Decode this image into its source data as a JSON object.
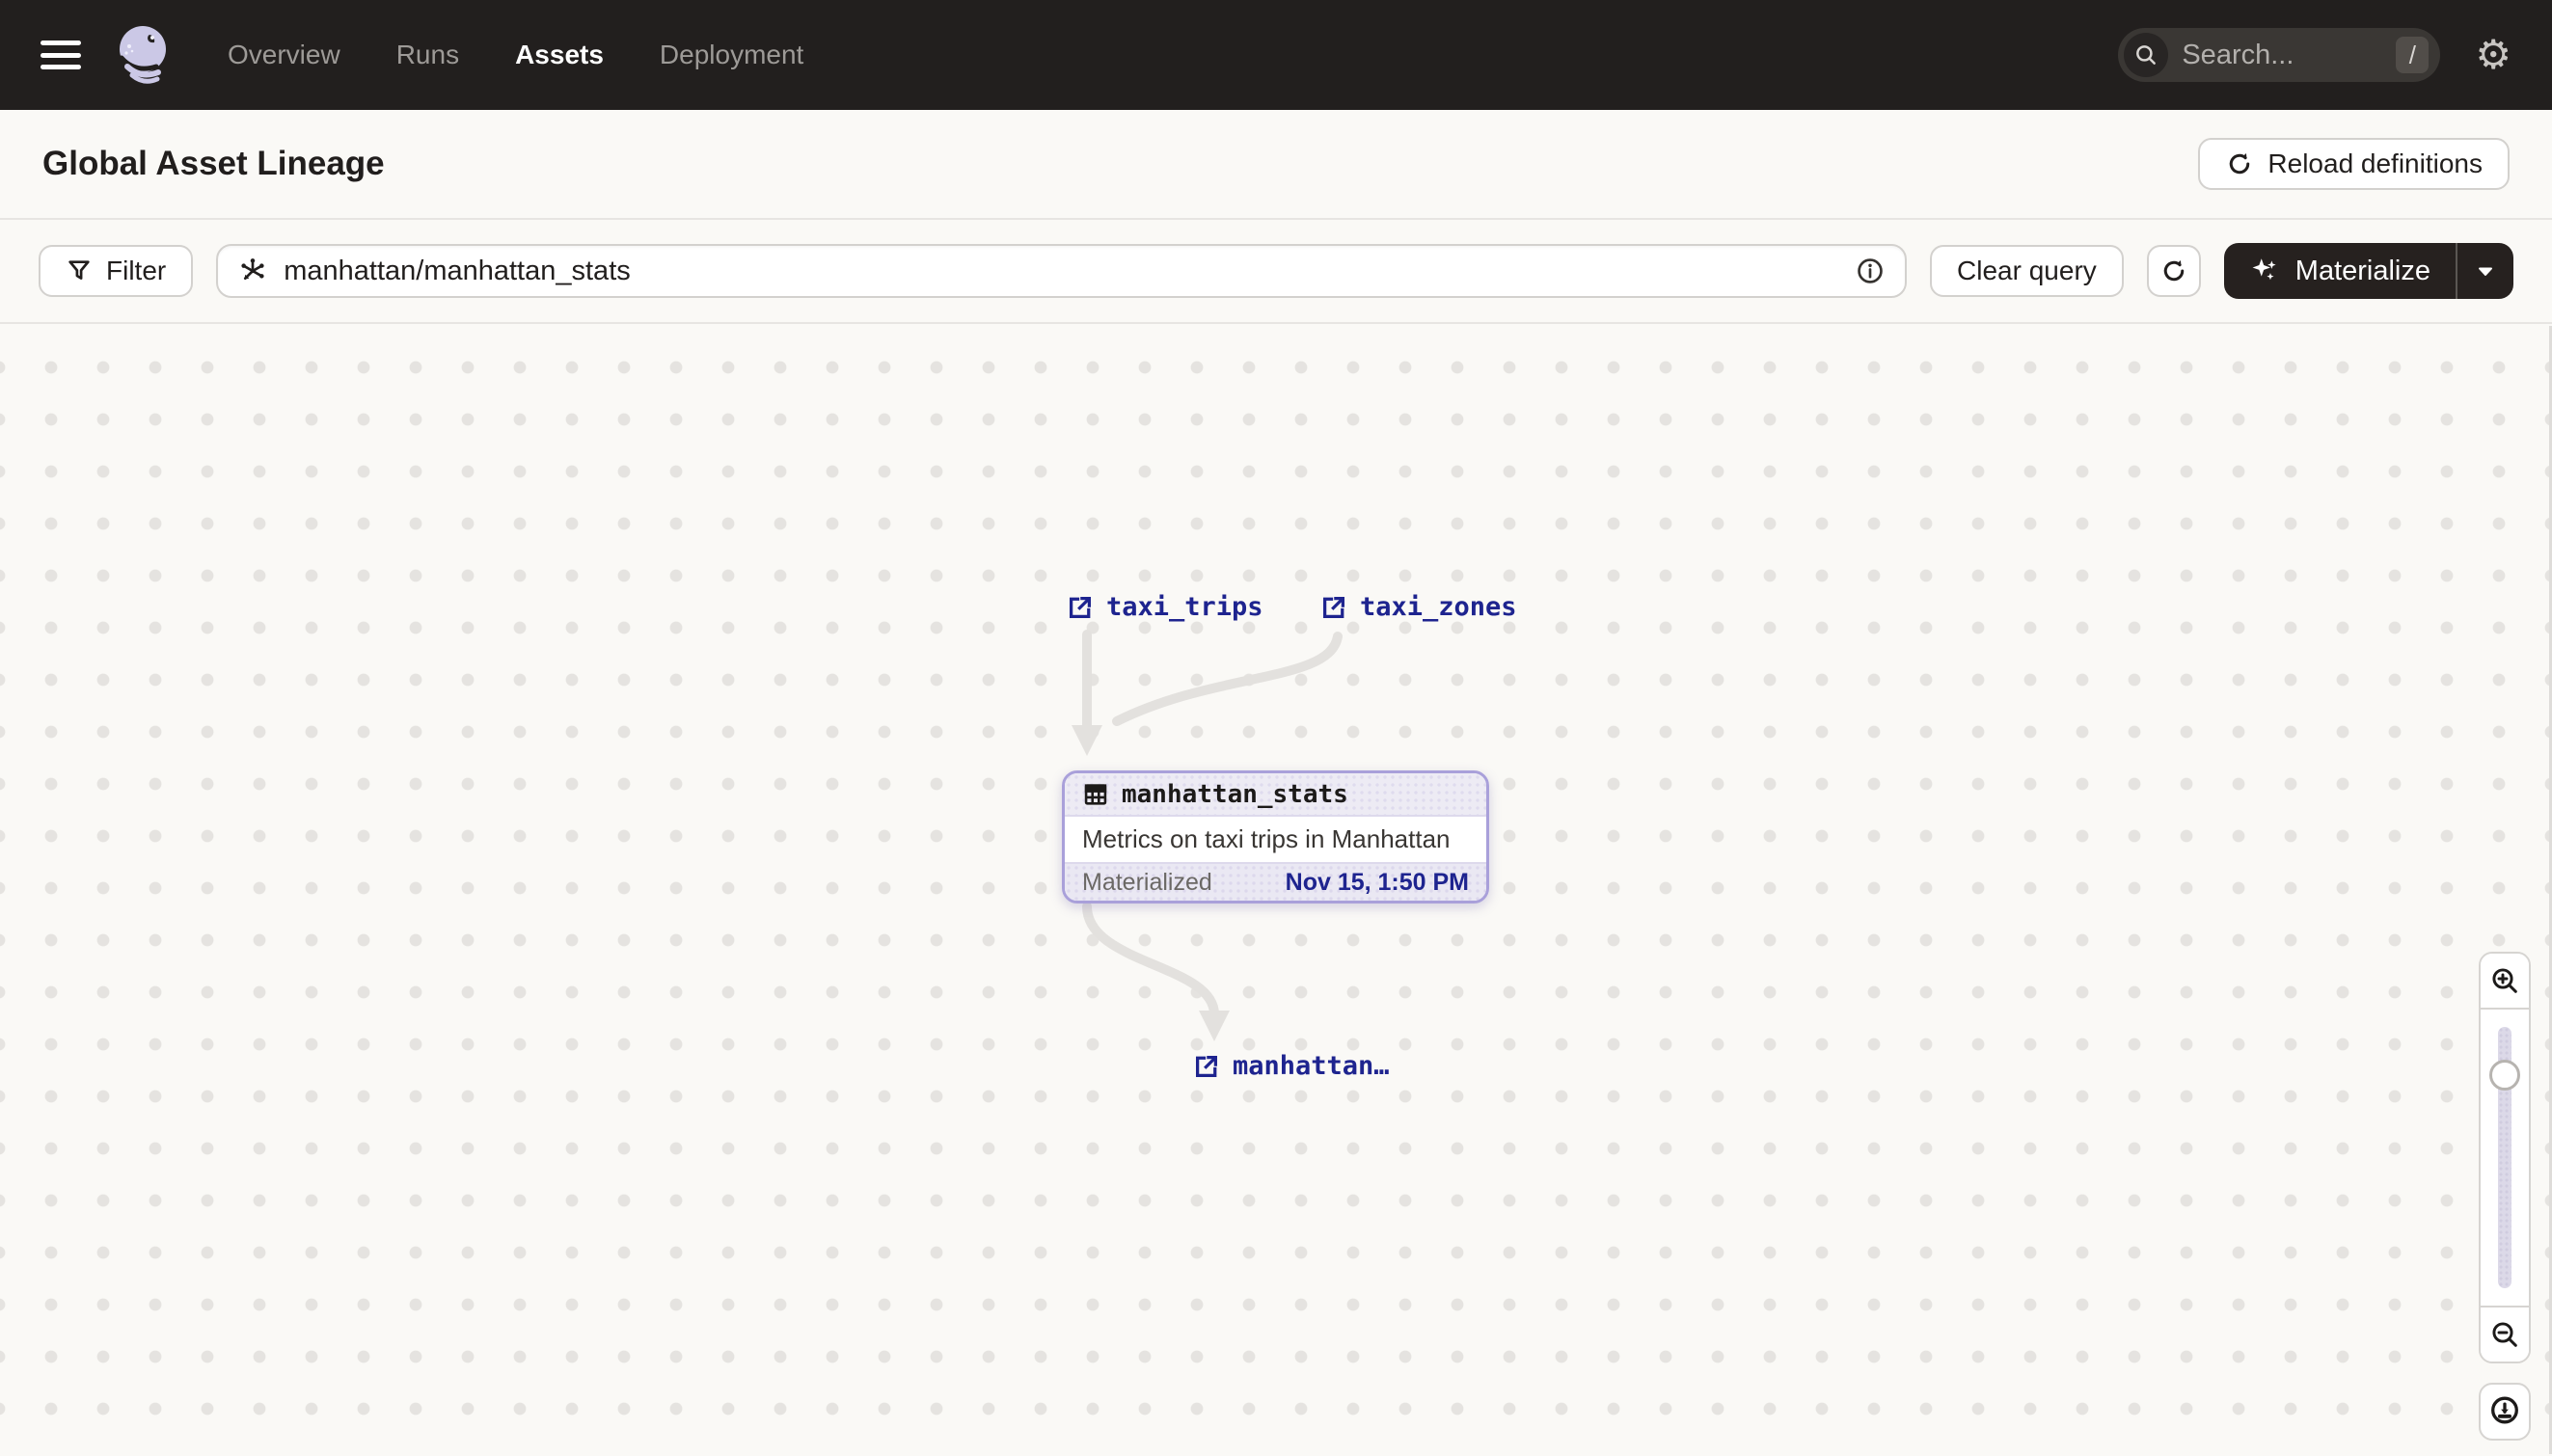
{
  "topbar": {
    "nav": [
      {
        "label": "Overview"
      },
      {
        "label": "Runs"
      },
      {
        "label": "Assets"
      },
      {
        "label": "Deployment"
      }
    ],
    "search": {
      "placeholder": "Search...",
      "shortcut": "/"
    }
  },
  "header": {
    "title": "Global Asset Lineage",
    "reload_button_label": "Reload definitions"
  },
  "toolbar": {
    "filter_label": "Filter",
    "query": {
      "value": "manhattan/manhattan_stats"
    },
    "clear_query_label": "Clear query",
    "materialize_label": "Materialize"
  },
  "graph": {
    "upstream_nodes": [
      {
        "label": "taxi_trips"
      },
      {
        "label": "taxi_zones"
      }
    ],
    "card": {
      "title": "manhattan_stats",
      "description": "Metrics on taxi trips in Manhattan",
      "status_label": "Materialized",
      "status_time": "Nov 15, 1:50 PM"
    },
    "downstream_node": {
      "label": "manhattan…"
    }
  },
  "icons": {
    "gear_glyph": "⚙",
    "names": {
      "menu": "hamburger",
      "logo": "dagster-octopus",
      "search": "magnifier",
      "settings": "gear",
      "reload": "refresh-circular-arrow",
      "filter": "funnel",
      "query": "op-selector-asterisk",
      "info": "info-circle",
      "refresh": "refresh-circular-arrow",
      "materialize": "sparkles",
      "dropdown": "caret-down",
      "asset_link": "external-link",
      "asset_table": "table-grid",
      "zoom_in": "magnifier-plus",
      "zoom_out": "magnifier-minus",
      "export": "download-circle"
    }
  },
  "colors": {
    "topbar_bg": "#221f1e",
    "canvas_bg": "#faf9f6",
    "asset_link": "#1e248f",
    "card_border": "#a9a0da",
    "edge": "#e3e1de",
    "materialize_bg": "#26211f"
  }
}
